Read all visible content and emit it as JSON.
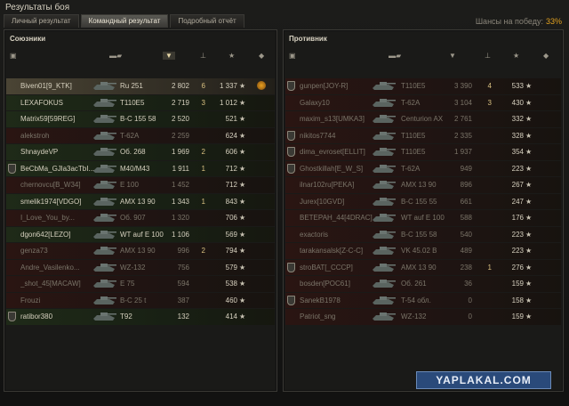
{
  "window": {
    "title": "Результаты боя"
  },
  "tabs": [
    {
      "label": "Личный результат",
      "active": false
    },
    {
      "label": "Командный результат",
      "active": true
    },
    {
      "label": "Подробный отчёт",
      "active": false
    }
  ],
  "win_chance": {
    "label": "Шансы на победу:",
    "value": "33%"
  },
  "allies": {
    "title": "Союзники",
    "rows": [
      {
        "player": "Biven01[9_KTK]",
        "tank": "Ru 251",
        "damage": "2 802",
        "frags": "6",
        "xp": "1 337",
        "alive": true,
        "squad": false,
        "hl": true,
        "medal": true
      },
      {
        "player": "LEXAFOKUS",
        "tank": "T110E5",
        "damage": "2 719",
        "frags": "3",
        "xp": "1 012",
        "alive": true,
        "squad": false
      },
      {
        "player": "Matrix59[59REG]",
        "tank": "B-C 155 58",
        "damage": "2 520",
        "frags": "",
        "xp": "521",
        "alive": true,
        "squad": false
      },
      {
        "player": "alekstroh",
        "tank": "T-62A",
        "damage": "2 259",
        "frags": "",
        "xp": "624",
        "alive": false,
        "squad": false
      },
      {
        "player": "ShnaydeVP",
        "tank": "Об. 268",
        "damage": "1 969",
        "frags": "2",
        "xp": "606",
        "alive": true,
        "squad": false
      },
      {
        "player": "BeCbMa_GJla3acTbI...",
        "tank": "M40/M43",
        "damage": "1 911",
        "frags": "1",
        "xp": "712",
        "alive": true,
        "squad": true
      },
      {
        "player": "chernovcu[B_W34]",
        "tank": "E 100",
        "damage": "1 452",
        "frags": "",
        "xp": "712",
        "alive": false,
        "squad": false
      },
      {
        "player": "smelik1974[VDGO]",
        "tank": "AMX 13 90",
        "damage": "1 343",
        "frags": "1",
        "xp": "843",
        "alive": true,
        "squad": false
      },
      {
        "player": "I_Love_You_by...",
        "tank": "Об. 907",
        "damage": "1 320",
        "frags": "",
        "xp": "706",
        "alive": false,
        "squad": false
      },
      {
        "player": "dgon642[LEZO]",
        "tank": "WT auf E 100",
        "damage": "1 106",
        "frags": "",
        "xp": "569",
        "alive": true,
        "squad": false
      },
      {
        "player": "genza73",
        "tank": "AMX 13 90",
        "damage": "996",
        "frags": "2",
        "xp": "794",
        "alive": false,
        "squad": false
      },
      {
        "player": "Andre_Vasilenko...",
        "tank": "WZ-132",
        "damage": "756",
        "frags": "",
        "xp": "579",
        "alive": false,
        "squad": false
      },
      {
        "player": "_shot_45[MACAW]",
        "tank": "E 75",
        "damage": "594",
        "frags": "",
        "xp": "538",
        "alive": false,
        "squad": false
      },
      {
        "player": "Frouzi",
        "tank": "B-C 25 t",
        "damage": "387",
        "frags": "",
        "xp": "460",
        "alive": false,
        "squad": false
      },
      {
        "player": "ratibor380",
        "tank": "T92",
        "damage": "132",
        "frags": "",
        "xp": "414",
        "alive": true,
        "squad": true
      }
    ]
  },
  "enemies": {
    "title": "Противник",
    "rows": [
      {
        "player": "gunpen[JOY-R]",
        "tank": "T110E5",
        "damage": "3 390",
        "frags": "4",
        "xp": "533",
        "alive": false,
        "squad": true
      },
      {
        "player": "Galaxy10",
        "tank": "T-62A",
        "damage": "3 104",
        "frags": "3",
        "xp": "430",
        "alive": false,
        "squad": false
      },
      {
        "player": "maxim_s13[UMKA3]",
        "tank": "Centurion AX",
        "damage": "2 761",
        "frags": "",
        "xp": "332",
        "alive": false,
        "squad": false
      },
      {
        "player": "nikitos7744",
        "tank": "T110E5",
        "damage": "2 335",
        "frags": "",
        "xp": "328",
        "alive": false,
        "squad": true
      },
      {
        "player": "dima_evroset[ELLIT]",
        "tank": "T110E5",
        "damage": "1 937",
        "frags": "",
        "xp": "354",
        "alive": false,
        "squad": true
      },
      {
        "player": "Ghostkillah[E_W_S]",
        "tank": "T-62A",
        "damage": "949",
        "frags": "",
        "xp": "223",
        "alive": false,
        "squad": true
      },
      {
        "player": "ilnar102ru[PEKA]",
        "tank": "AMX 13 90",
        "damage": "896",
        "frags": "",
        "xp": "267",
        "alive": false,
        "squad": false
      },
      {
        "player": "Jurex[10GVD]",
        "tank": "B-C 155 55",
        "damage": "661",
        "frags": "",
        "xp": "247",
        "alive": false,
        "squad": false
      },
      {
        "player": "ВЕТЕРАН_44[4DRAC]",
        "tank": "WT auf E 100",
        "damage": "588",
        "frags": "",
        "xp": "176",
        "alive": false,
        "squad": false
      },
      {
        "player": "exactoris",
        "tank": "B-C 155 58",
        "damage": "540",
        "frags": "",
        "xp": "223",
        "alive": false,
        "squad": false
      },
      {
        "player": "tarakansalsk[Z-C-C]",
        "tank": "VK 45.02 B",
        "damage": "489",
        "frags": "",
        "xp": "223",
        "alive": false,
        "squad": false
      },
      {
        "player": "stroBAT[_CCCP]",
        "tank": "AMX 13 90",
        "damage": "238",
        "frags": "1",
        "xp": "276",
        "alive": false,
        "squad": true
      },
      {
        "player": "bosden[POC61]",
        "tank": "Об. 261",
        "damage": "36",
        "frags": "",
        "xp": "159",
        "alive": false,
        "squad": false
      },
      {
        "player": "SanekB1978",
        "tank": "T-54 обл.",
        "damage": "0",
        "frags": "",
        "xp": "158",
        "alive": false,
        "squad": true
      },
      {
        "player": "Patriot_sng",
        "tank": "WZ-132",
        "damage": "0",
        "frags": "",
        "xp": "159",
        "alive": false,
        "squad": false
      }
    ]
  },
  "watermark": "YAPLAKAL.COM"
}
